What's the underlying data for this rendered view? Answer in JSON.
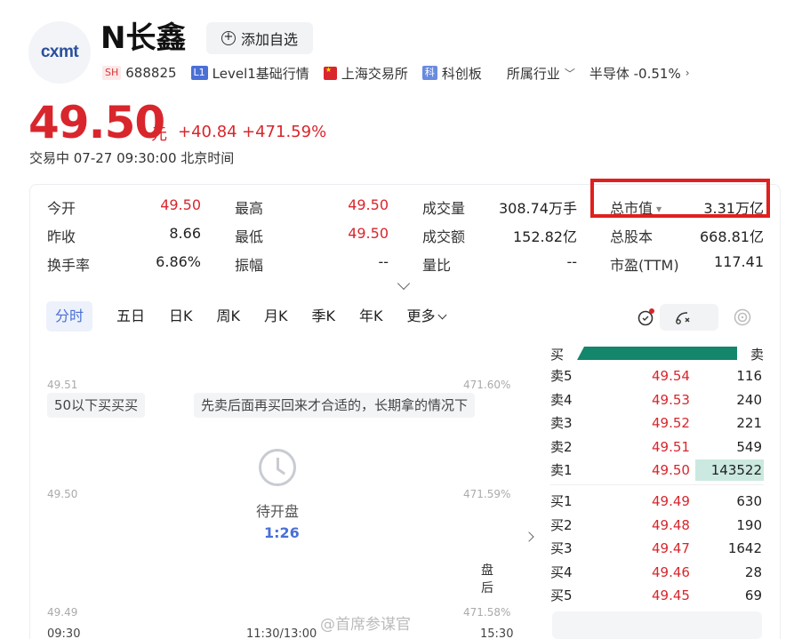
{
  "header": {
    "logo_text": "cxmt",
    "stock_name": "N长鑫",
    "watch_button": "添加自选",
    "exchange_badge": "SH",
    "code": "688825",
    "level_badge": "L1",
    "level_text": "Level1基础行情",
    "exchange_text": "上海交易所",
    "board_badge": "科",
    "board_text": "科创板",
    "industry_label": "所属行业",
    "industry_value": "半导体 -0.51%"
  },
  "quote": {
    "price": "49.50",
    "unit": "元",
    "change": "+40.84",
    "change_pct": "+471.59%",
    "status": "交易中  07-27 09:30:00 北京时间"
  },
  "stats": [
    {
      "label": "今开",
      "value": "49.50",
      "color": "red"
    },
    {
      "label": "最高",
      "value": "49.50",
      "color": "red"
    },
    {
      "label": "成交量",
      "value": "308.74万手",
      "color": "dark"
    },
    {
      "label": "总市值",
      "value": "3.31万亿",
      "color": "dark"
    },
    {
      "label": "昨收",
      "value": "8.66",
      "color": "dark"
    },
    {
      "label": "最低",
      "value": "49.50",
      "color": "red"
    },
    {
      "label": "成交额",
      "value": "152.82亿",
      "color": "dark"
    },
    {
      "label": "总股本",
      "value": "668.81亿",
      "color": "dark"
    },
    {
      "label": "换手率",
      "value": "6.86%",
      "color": "dark"
    },
    {
      "label": "振幅",
      "value": "--",
      "color": "dark"
    },
    {
      "label": "量比",
      "value": "--",
      "color": "dark"
    },
    {
      "label": "市盈(TTM)",
      "value": "117.41",
      "color": "dark"
    }
  ],
  "tabs": [
    "分时",
    "五日",
    "日K",
    "周K",
    "月K",
    "季K",
    "年K",
    "更多"
  ],
  "chart": {
    "y_top": "49.51",
    "y_mid": "49.50",
    "y_bot": "49.49",
    "pct_top": "471.60%",
    "pct_mid": "471.59%",
    "pct_bot": "471.58%",
    "x_start": "09:30",
    "x_mid": "11:30/13:00",
    "x_end": "15:30",
    "comment_1": "50以下买买买",
    "comment_2": "先卖后面再买回来才合适的，长期拿的情况下",
    "waiting": "待开盘",
    "countdown": "1:26",
    "post_label": "盘后"
  },
  "orderbook": {
    "buy_label": "买",
    "sell_label": "卖",
    "asks": [
      {
        "level": "卖5",
        "price": "49.54",
        "volume": "116"
      },
      {
        "level": "卖4",
        "price": "49.53",
        "volume": "240"
      },
      {
        "level": "卖3",
        "price": "49.52",
        "volume": "221"
      },
      {
        "level": "卖2",
        "price": "49.51",
        "volume": "549"
      },
      {
        "level": "卖1",
        "price": "49.50",
        "volume": "143522"
      }
    ],
    "bids": [
      {
        "level": "买1",
        "price": "49.49",
        "volume": "630"
      },
      {
        "level": "买2",
        "price": "49.48",
        "volume": "190"
      },
      {
        "level": "买3",
        "price": "49.47",
        "volume": "1642"
      },
      {
        "level": "买4",
        "price": "49.46",
        "volume": "28"
      },
      {
        "level": "买5",
        "price": "49.45",
        "volume": "69"
      }
    ]
  },
  "watermark": "@首席参谋官",
  "icons": {
    "add": "plus-circle-icon",
    "industry_more": "chevron-right-icon",
    "expand": "chevron-down-icon",
    "clock": "clock-icon"
  },
  "colors": {
    "up_red": "#d8262c",
    "accent_blue": "#4a6fd6",
    "buy_green": "#13866b",
    "highlight_box": "#e0201e"
  }
}
